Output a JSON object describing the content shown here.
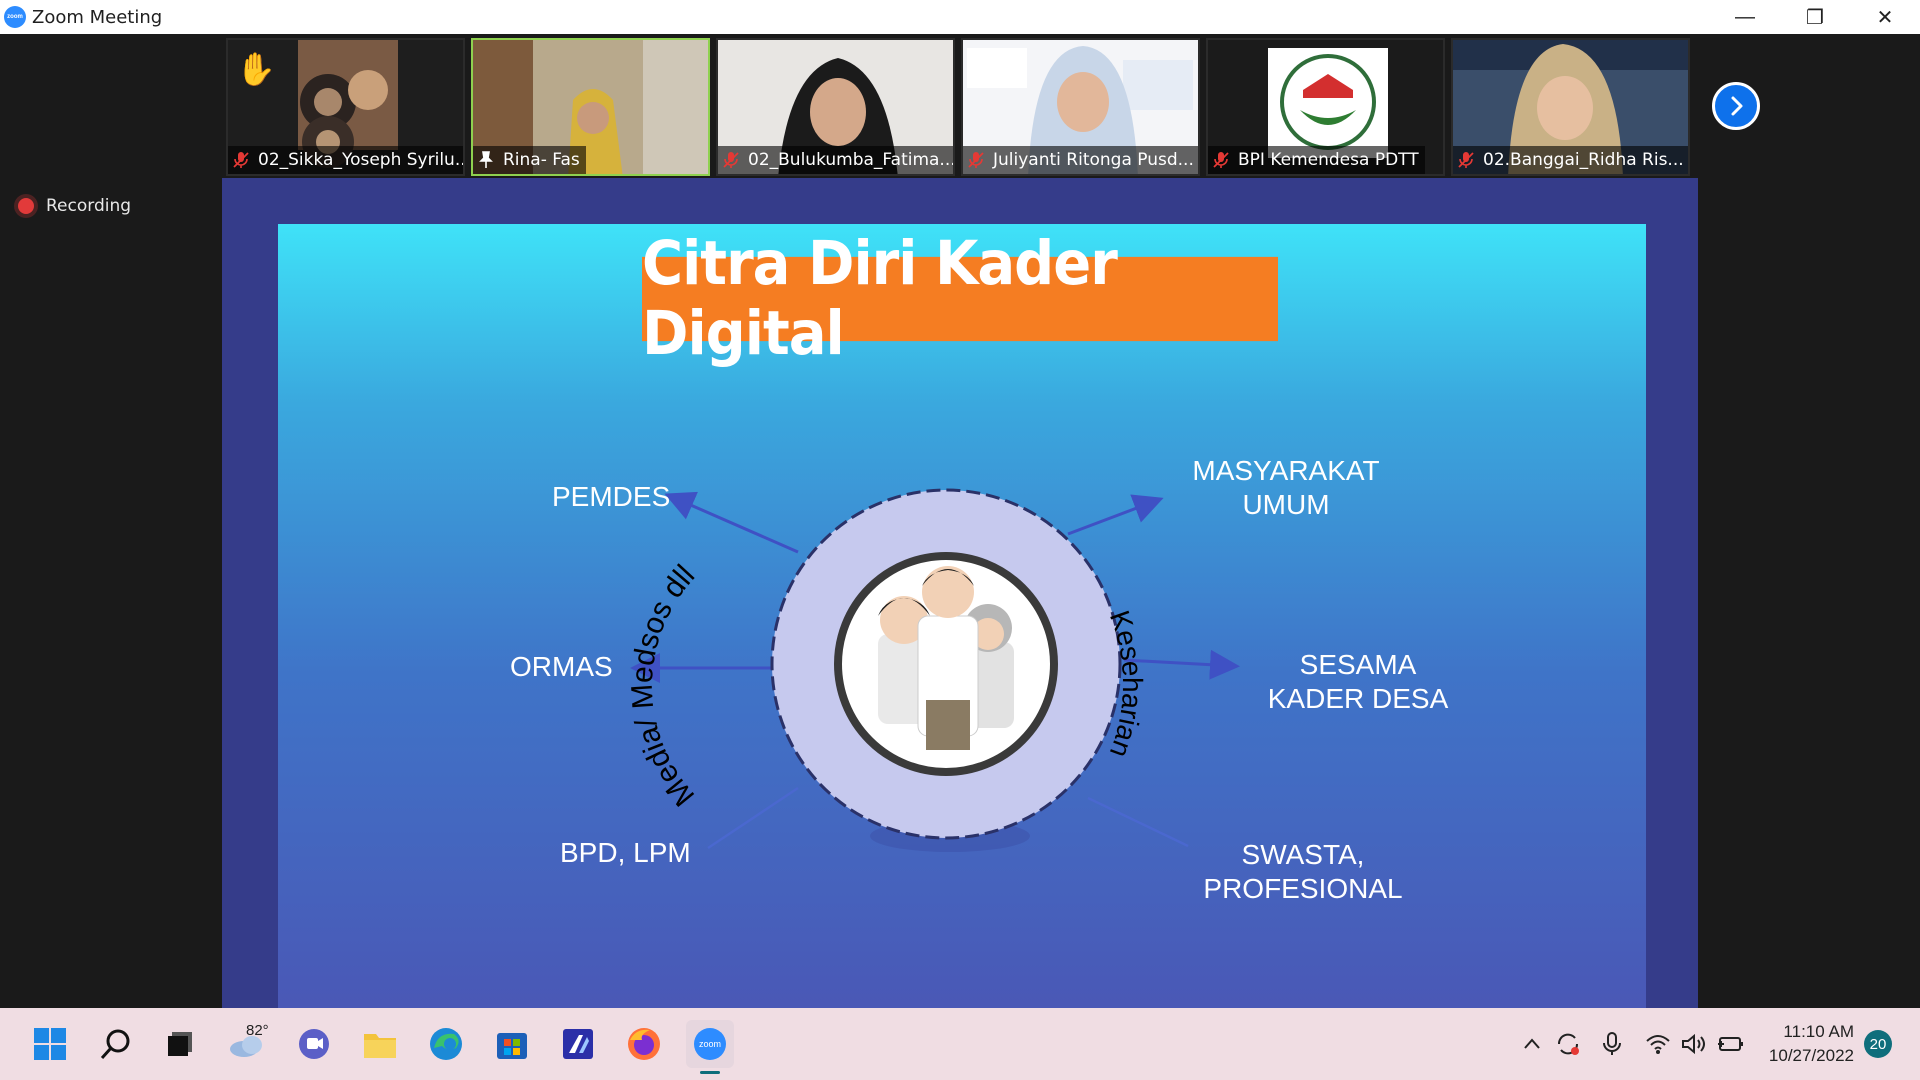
{
  "window": {
    "title": "Zoom Meeting",
    "minimize_glyph": "—",
    "restore_glyph": "❐",
    "close_glyph": "✕"
  },
  "gallery": {
    "participants": [
      {
        "name": "02_Sikka_Yoseph Syrilu...",
        "mic": "muted",
        "hand_raised": true
      },
      {
        "name": "Rina- Fas",
        "mic": "pinned",
        "active_speaker": true
      },
      {
        "name": "02_Bulukumba_Fatima...",
        "mic": "muted"
      },
      {
        "name": "Juliyanti Ritonga Pusd...",
        "mic": "muted"
      },
      {
        "name": "BPI Kemendesa PDTT",
        "mic": "muted"
      },
      {
        "name": "02.Banggai_Ridha Ris...",
        "mic": "muted"
      }
    ],
    "next_icon": "chevron-right-icon"
  },
  "recording": {
    "label": "Recording"
  },
  "slide": {
    "title": "Citra Diri Kader Digital",
    "ring_left_text": "Media/ Medsos dll",
    "ring_right_text": "Keseharian",
    "labels": {
      "pemdes": "PEMDES",
      "masyarakat_1": "MASYARAKAT",
      "masyarakat_2": "UMUM",
      "ormas": "ORMAS",
      "sesama_1": "SESAMA",
      "sesama_2": "KADER DESA",
      "bpd": "BPD, LPM",
      "swasta_1": "SWASTA,",
      "swasta_2": "PROFESIONAL"
    },
    "colors": {
      "title_bg": "#f57d22",
      "ring": "#c6c9ee",
      "arrow": "#3f51c4"
    }
  },
  "taskbar": {
    "weather_temp": "82°",
    "time": "11:10 AM",
    "date": "10/27/2022",
    "notification_count": "20"
  }
}
